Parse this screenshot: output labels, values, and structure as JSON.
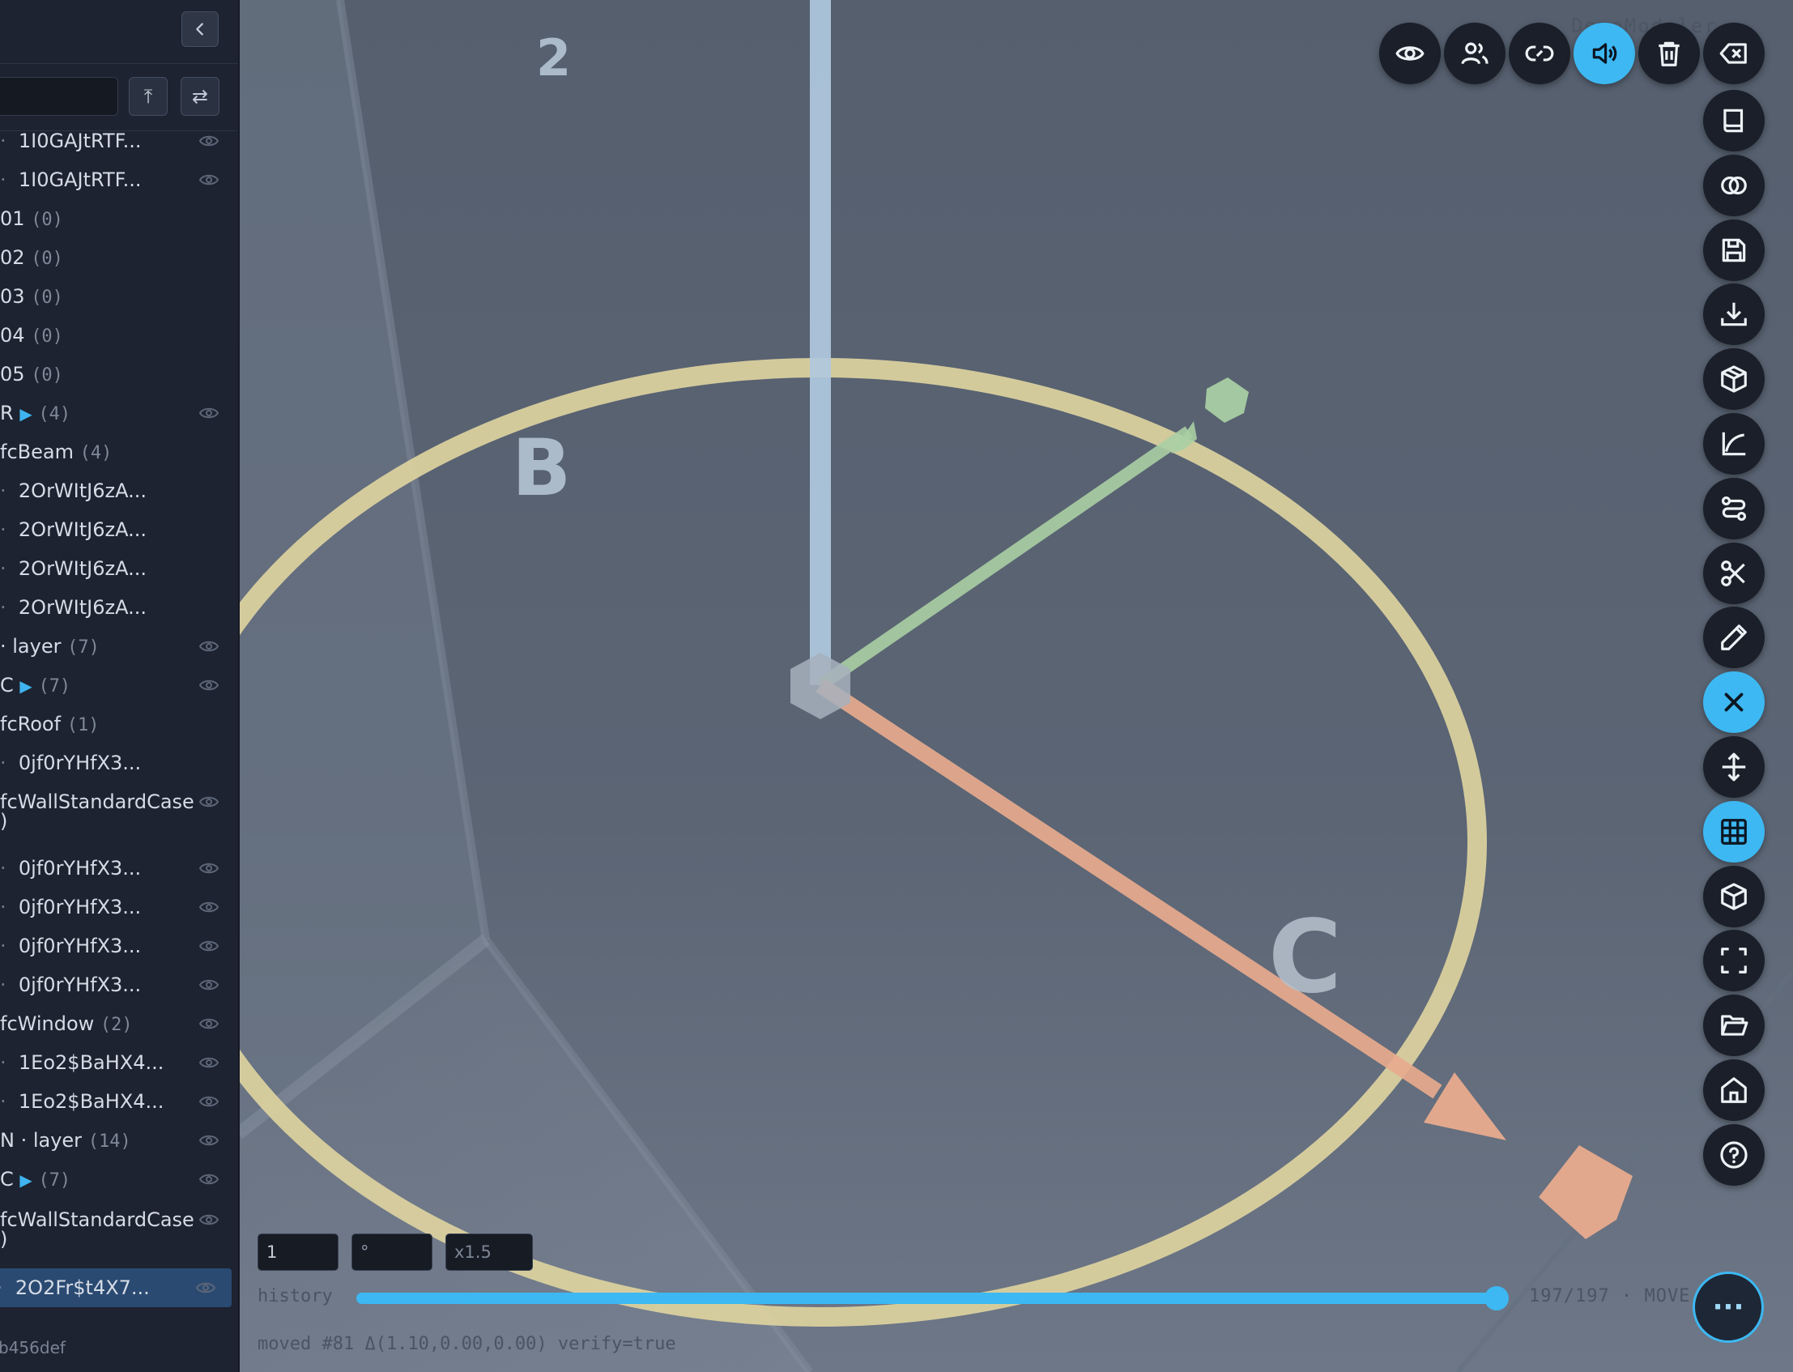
{
  "viewport": {
    "labels": {
      "grid_2": "2",
      "grid_b": "B",
      "grid_c": "C"
    },
    "watermark": "DemoModeler",
    "colors": {
      "ring": "#ddd3a0",
      "x_axis": "#e8ab8e",
      "y_axis": "#aacfa4",
      "z_axis": "#b0c9de",
      "accent": "#3db8f2"
    }
  },
  "sidebar": {
    "search": {
      "value": "",
      "placeholder": ""
    },
    "buttons": {
      "top": "⤒",
      "swap": "⇄"
    },
    "tree": [
      {
        "text": "1I0GAJtRTF...",
        "count": "",
        "bullet": true,
        "eye": true
      },
      {
        "text": "1I0GAJtRTF...",
        "count": "",
        "bullet": true,
        "eye": true
      },
      {
        "text": "01",
        "count": "(0)",
        "bullet": false,
        "eye": false
      },
      {
        "text": "02",
        "count": "(0)",
        "bullet": false,
        "eye": false
      },
      {
        "text": "03",
        "count": "(0)",
        "bullet": false,
        "eye": false
      },
      {
        "text": "04",
        "count": "(0)",
        "bullet": false,
        "eye": false
      },
      {
        "text": "05",
        "count": "(0)",
        "bullet": false,
        "eye": false
      },
      {
        "text": "R",
        "tri": "▶",
        "count": "(4)",
        "bullet": false,
        "eye": true
      },
      {
        "text": "fcBeam",
        "count": "(4)",
        "bullet": false,
        "eye": false
      },
      {
        "text": "2OrWItJ6zA...",
        "count": "",
        "bullet": true,
        "eye": false
      },
      {
        "text": "2OrWItJ6zA...",
        "count": "",
        "bullet": true,
        "eye": false
      },
      {
        "text": "2OrWItJ6zA...",
        "count": "",
        "bullet": true,
        "eye": false
      },
      {
        "text": "2OrWItJ6zA...",
        "count": "",
        "bullet": true,
        "eye": false
      },
      {
        "text": "· layer",
        "count": "(7)",
        "bullet": false,
        "eye": true
      },
      {
        "text": "C",
        "tri": "▶",
        "count": "(7)",
        "bullet": false,
        "eye": true
      },
      {
        "text": "fcRoof",
        "count": "(1)",
        "bullet": false,
        "eye": false
      },
      {
        "text": "0jf0rYHfX3...",
        "count": "",
        "bullet": true,
        "eye": false
      },
      {
        "text": "fcWallStandardCase",
        "count": "",
        "bullet": false,
        "eye": true,
        "wrap": ")"
      },
      {
        "text": "0jf0rYHfX3...",
        "count": "",
        "bullet": true,
        "eye": true
      },
      {
        "text": "0jf0rYHfX3...",
        "count": "",
        "bullet": true,
        "eye": true
      },
      {
        "text": "0jf0rYHfX3...",
        "count": "",
        "bullet": true,
        "eye": true
      },
      {
        "text": "0jf0rYHfX3...",
        "count": "",
        "bullet": true,
        "eye": true
      },
      {
        "text": "fcWindow",
        "count": "(2)",
        "bullet": false,
        "eye": true
      },
      {
        "text": "1Eo2$BaHX4...",
        "count": "",
        "bullet": true,
        "eye": true
      },
      {
        "text": "1Eo2$BaHX4...",
        "count": "",
        "bullet": true,
        "eye": true
      },
      {
        "text": "N · layer",
        "count": "(14)",
        "bullet": false,
        "eye": true
      },
      {
        "text": "C",
        "tri": "▶",
        "count": "(7)",
        "bullet": false,
        "eye": true
      },
      {
        "text": "fcWallStandardCase",
        "count": "",
        "bullet": false,
        "eye": true,
        "wrap": ")"
      },
      {
        "text": "2O2Fr$t4X7...",
        "count": "",
        "bullet": true,
        "eye": true,
        "selected": true
      }
    ],
    "footer": "b456def"
  },
  "toolbar": {
    "top": [
      "eye-icon",
      "users-icon",
      "link-icon",
      "volume-icon",
      "trash-icon",
      "backspace-icon"
    ],
    "side": [
      "book-icon",
      "intersect-icon",
      "save-icon",
      "download-icon",
      "box-icon",
      "curve-icon",
      "route-icon",
      "scissors-icon",
      "pencil-icon",
      "close-icon",
      "move-vertical-icon",
      "grid-icon",
      "cube-icon",
      "fullscreen-icon",
      "folder-open-icon",
      "home-icon",
      "help-icon"
    ]
  },
  "bottom": {
    "input_step": "1",
    "input_angle": "°",
    "input_scale_placeholder": "x1.5",
    "history_label": "history",
    "progress": "197/197 · MOVE",
    "progress_fraction": 1.0,
    "status": "moved #81 Δ(1.10,0.00,0.00)  verify=true",
    "more": "···"
  }
}
